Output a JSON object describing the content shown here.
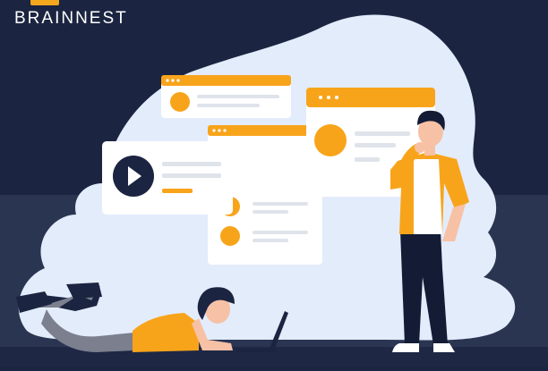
{
  "brand": {
    "name": "BRAINNEST",
    "accent_color": "#f4a81d"
  },
  "scene": {
    "background_color": "#1b2440",
    "cloud_color": "#e3ecfb",
    "floor_color": "#2a3552",
    "card_color": "#ffffff",
    "card_header_color": "#f8a41b",
    "icons": [
      "play-icon",
      "window-dots-icon"
    ]
  }
}
